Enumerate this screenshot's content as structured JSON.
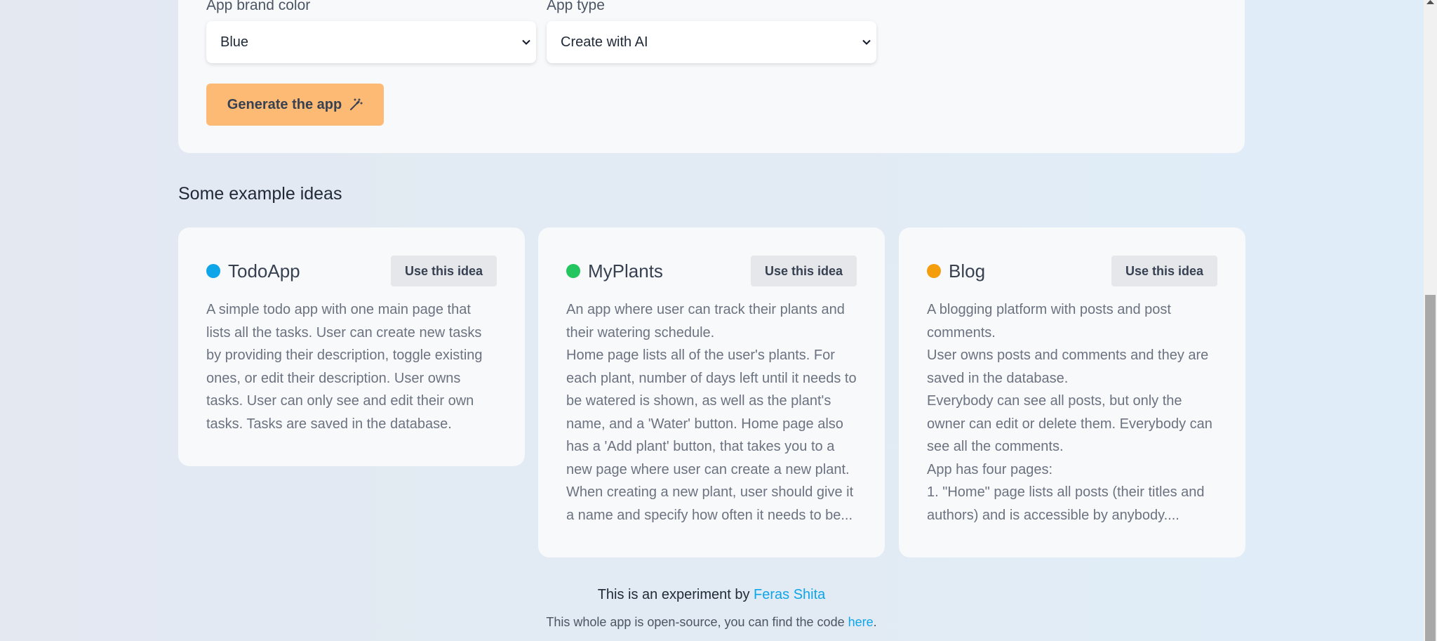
{
  "form": {
    "brand_color_label": "App brand color",
    "brand_color_value": "Blue",
    "app_type_label": "App type",
    "app_type_value": "Create with AI",
    "generate_label": "Generate the app",
    "generate_icon": "magic-wand-icon",
    "generate_color": "#fdba74"
  },
  "examples": {
    "title": "Some example ideas",
    "use_label": "Use this idea",
    "ideas": [
      {
        "name": "TodoApp",
        "color": "#0ea5e9",
        "description": "A simple todo app with one main page that lists all the tasks. User can create new tasks by providing their description, toggle existing ones, or edit their description. User owns tasks. User can only see and edit their own tasks. Tasks are saved in the database."
      },
      {
        "name": "MyPlants",
        "color": "#22c55e",
        "description": "An app where user can track their plants and their watering schedule.\nHome page lists all of the user's plants. For each plant, number of days left until it needs to be watered is shown, as well as the plant's name, and a 'Water' button. Home page also has a 'Add plant' button, that takes you to a new page where user can create a new plant.\nWhen creating a new plant, user should give it a name and specify how often it needs to be..."
      },
      {
        "name": "Blog",
        "color": "#f59e0b",
        "description": "A blogging platform with posts and post comments.\nUser owns posts and comments and they are saved in the database.\nEverybody can see all posts, but only the owner can edit or delete them. Everybody can see all the comments.\nApp has four pages:\n1. \"Home\" page lists all posts (their titles and authors) and is accessible by anybody...."
      }
    ]
  },
  "footer": {
    "experiment_prefix": "This is an experiment by",
    "author": "Feras Shita",
    "opensource_prefix": "This whole app is open-source, you can find the code",
    "code_link": "here",
    "suffix": "."
  }
}
